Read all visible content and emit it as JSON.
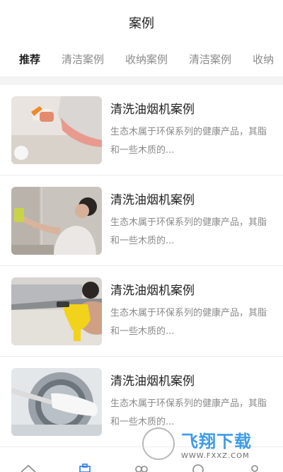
{
  "header": {
    "title": "案例"
  },
  "tabs": [
    {
      "label": "推荐",
      "active": true
    },
    {
      "label": "清洁案例",
      "active": false
    },
    {
      "label": "收纳案例",
      "active": false
    },
    {
      "label": "清洁案例",
      "active": false
    },
    {
      "label": "收纳",
      "active": false
    }
  ],
  "items": [
    {
      "title": "清洗油烟机案例",
      "desc": "生态木属于环保系列的健康产品，其脂和一些木质的...",
      "image": "spray-cleaning-photo"
    },
    {
      "title": "清洗油烟机案例",
      "desc": "生态木属于环保系列的健康产品，其脂和一些木质的...",
      "image": "woman-wiping-wall-photo"
    },
    {
      "title": "清洗油烟机案例",
      "desc": "生态木属于环保系列的健康产品，其脂和一些木质的...",
      "image": "steam-cleaning-hood-photo"
    },
    {
      "title": "清洗油烟机案例",
      "desc": "生态木属于环保系列的健康产品，其脂和一些木质的...",
      "image": "washing-machine-brush-photo"
    }
  ],
  "watermark": {
    "big": "飞翔下载",
    "small": "WWW.FXXZ.COM"
  },
  "bottom_nav": [
    {
      "icon": "home-icon"
    },
    {
      "icon": "cases-icon"
    },
    {
      "icon": "services-icon"
    },
    {
      "icon": "compass-icon"
    },
    {
      "icon": "profile-icon"
    }
  ],
  "colors": {
    "accent": "#2f7de1",
    "muted": "#8a8a8a",
    "divider": "#ececec"
  }
}
